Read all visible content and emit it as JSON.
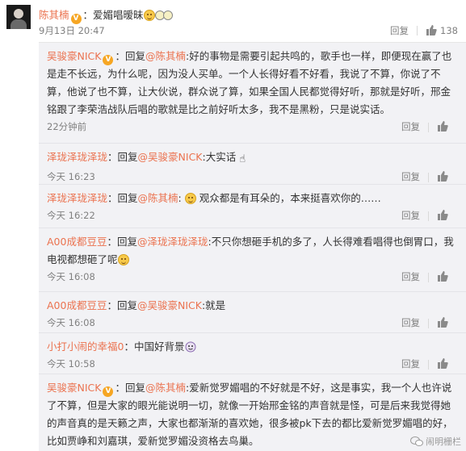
{
  "post": {
    "author": "陈其楠",
    "verified_badge": "V",
    "text": "爱媚唱暧昧",
    "emoji_1": "smile-emoji",
    "emoji_2": "wow-emoji",
    "date": "9月13日 20:47",
    "reply_label": "回复",
    "like_count": "138"
  },
  "replies": [
    {
      "author": "吴骏豪NICK",
      "badge": "V",
      "prefix": "：回复",
      "mention": "@陈其楠",
      "body": ":好的事物是需要引起共鸣的，歌手也一样，即便现在赢了也是走不长远，为什么呢，因为没人买单。一个人长得好看不好看，我说了不算，你说了不算，他说了也不算，让大伙说，群众说了算，如果全国人民都觉得好听，那就是好听，邢金铭跟了李荣浩战队后唱的歌就是比之前好听太多，我不是黑粉，只是说实话。",
      "time": "22分钟前",
      "reply_label": "回复"
    },
    {
      "author": "泽珑泽珑泽珑",
      "prefix": "：回复",
      "mention": "@吴骏豪NICK",
      "body": ":大实话",
      "time": "今天 16:23",
      "reply_label": "回复"
    },
    {
      "author": "泽珑泽珑泽珑",
      "prefix": "：回复",
      "mention": "@陈其楠",
      "body": "观众都是有耳朵的，本来挺喜欢你的……",
      "time": "今天 16:22",
      "reply_label": "回复"
    },
    {
      "author": "A00成都豆豆",
      "prefix": "：回复",
      "mention": "@泽珑泽珑泽珑",
      "body": ":不只你想砸手机的多了，人长得难看唱得也倒胃口，我电视都想砸了呢",
      "time": "今天 16:08",
      "reply_label": "回复"
    },
    {
      "author": "A00成都豆豆",
      "prefix": "：回复",
      "mention": "@吴骏豪NICK",
      "body": ":就是",
      "time": "今天 16:08",
      "reply_label": "回复"
    },
    {
      "author": "小打小闹的幸福0",
      "prefix": "：",
      "mention": "",
      "body": "中国好背景",
      "time": "今天 10:58",
      "reply_label": "回复"
    },
    {
      "author": "吴骏豪NICK",
      "badge": "V",
      "prefix": "：回复",
      "mention": "@陈其楠",
      "body": ":爱新觉罗媚唱的不好就是不好，这是事实，我一个人也许说了不算，但是大家的眼光能说明一切，就像一开始邢金铭的声音就是怪，可是后来我觉得她的声音真的是天籁之声，大家也都渐渐的喜欢她，很多被pk下去的都比爱新觉罗媚唱的好，比如贾峥和刘嘉琪，爱新觉罗媚没资格去鸟巢。"
    }
  ],
  "watermark": "闹明栅栏"
}
